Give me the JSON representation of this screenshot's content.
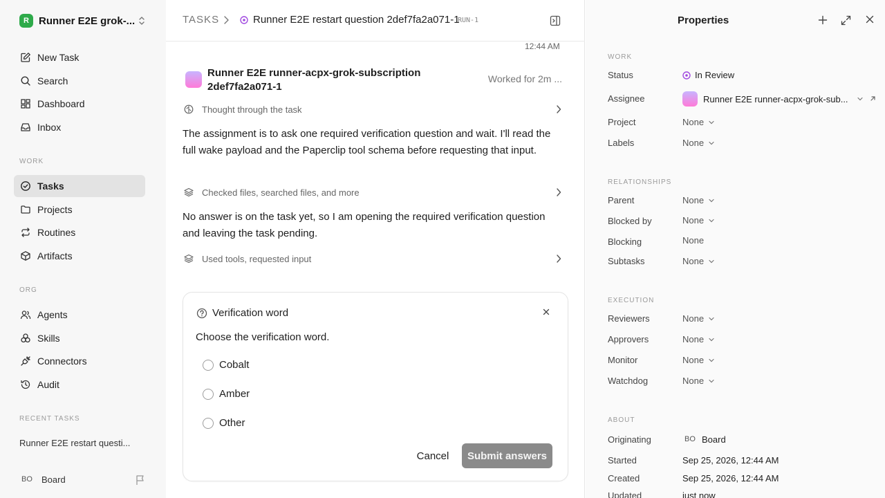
{
  "sidebar": {
    "workspace_name": "Runner E2E grok-...",
    "workspace_initial": "R",
    "primary_nav": [
      {
        "label": "New Task",
        "icon": "edit-icon"
      },
      {
        "label": "Search",
        "icon": "search-icon"
      },
      {
        "label": "Dashboard",
        "icon": "dashboard-icon"
      },
      {
        "label": "Inbox",
        "icon": "inbox-icon"
      }
    ],
    "work_label": "WORK",
    "work_nav": [
      {
        "label": "Tasks",
        "icon": "check-circle-icon",
        "active": true
      },
      {
        "label": "Projects",
        "icon": "folder-icon"
      },
      {
        "label": "Routines",
        "icon": "repeat-icon"
      },
      {
        "label": "Artifacts",
        "icon": "box-icon"
      }
    ],
    "org_label": "ORG",
    "org_nav": [
      {
        "label": "Agents",
        "icon": "users-icon"
      },
      {
        "label": "Skills",
        "icon": "skills-icon"
      },
      {
        "label": "Connectors",
        "icon": "plug-icon"
      },
      {
        "label": "Audit",
        "icon": "history-icon"
      }
    ],
    "recent_label": "RECENT TASKS",
    "recent_items": [
      "Runner E2E restart questi..."
    ],
    "user_initials": "BO",
    "user_name": "Board"
  },
  "header": {
    "root": "TASKS",
    "title": "Runner E2E restart question 2def7fa2a071-1",
    "run_tag": "RUN-1"
  },
  "thread": {
    "timestamp": "12:44 AM",
    "agent_name": "Runner E2E runner-acpx-grok-subscription 2def7fa2a071-1",
    "worked": "Worked for 2m ...",
    "steps": [
      "Thought through the task",
      "Checked files, searched files, and more",
      "Used tools, requested input"
    ],
    "paragraphs": [
      "The assignment is to ask one required verification question and wait. I'll read the full wake payload and the Paperclip tool schema before requesting that input.",
      "No answer is on the task yet, so I am opening the required verification question and leaving the task pending."
    ]
  },
  "question": {
    "title": "Verification word",
    "prompt": "Choose the verification word.",
    "options": [
      "Cobalt",
      "Amber",
      "Other"
    ],
    "cancel_label": "Cancel",
    "submit_label": "Submit answers"
  },
  "properties": {
    "title": "Properties",
    "work_label": "WORK",
    "status_key": "Status",
    "status_value": "In Review",
    "assignee_key": "Assignee",
    "assignee_value": "Runner E2E runner-acpx-grok-sub...",
    "project_key": "Project",
    "project_value": "None",
    "labels_key": "Labels",
    "labels_value": "None",
    "relationships_label": "RELATIONSHIPS",
    "parent_key": "Parent",
    "parent_value": "None",
    "blocked_by_key": "Blocked by",
    "blocked_by_value": "None",
    "blocking_key": "Blocking",
    "blocking_value": "None",
    "subtasks_key": "Subtasks",
    "subtasks_value": "None",
    "execution_label": "EXECUTION",
    "reviewers_key": "Reviewers",
    "reviewers_value": "None",
    "approvers_key": "Approvers",
    "approvers_value": "None",
    "monitor_key": "Monitor",
    "monitor_value": "None",
    "watchdog_key": "Watchdog",
    "watchdog_value": "None",
    "about_label": "ABOUT",
    "originating_key": "Originating",
    "originating_initials": "BO",
    "originating_value": "Board",
    "started_key": "Started",
    "started_value": "Sep 25, 2026, 12:44 AM",
    "created_key": "Created",
    "created_value": "Sep 25, 2026, 12:44 AM",
    "updated_key": "Updated",
    "updated_value": "just now"
  },
  "colors": {
    "accent_purple": "#a14ae0",
    "workspace_green": "#2eaa4a",
    "submit_gray": "#8a8a8a"
  }
}
